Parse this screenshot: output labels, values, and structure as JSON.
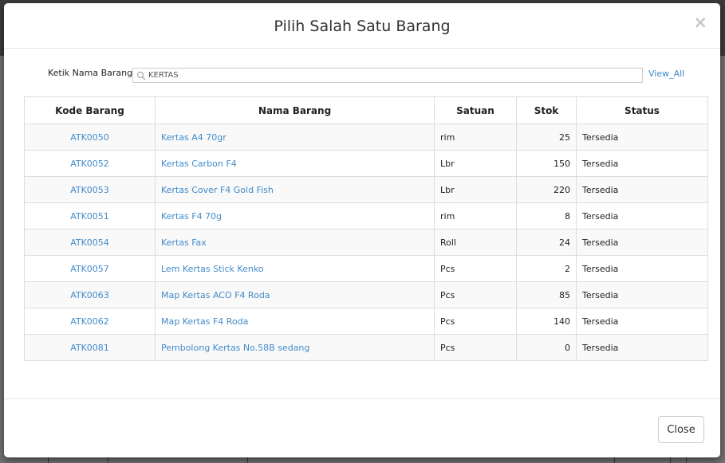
{
  "modal": {
    "title": "Pilih Salah Satu Barang",
    "close_symbol": "×",
    "close_button": "Close"
  },
  "search": {
    "label": "Ketik Nama Barang :",
    "value": "KERTAS",
    "view_all": "View_All"
  },
  "table": {
    "headers": [
      "Kode Barang",
      "Nama Barang",
      "Satuan",
      "Stok",
      "Status"
    ],
    "rows": [
      {
        "kode": "ATK0050",
        "nama": "Kertas A4 70gr",
        "satuan": "rim",
        "stok": "25",
        "status": "Tersedia"
      },
      {
        "kode": "ATK0052",
        "nama": "Kertas Carbon F4",
        "satuan": "Lbr",
        "stok": "150",
        "status": "Tersedia"
      },
      {
        "kode": "ATK0053",
        "nama": "Kertas Cover F4 Gold Fish",
        "satuan": "Lbr",
        "stok": "220",
        "status": "Tersedia"
      },
      {
        "kode": "ATK0051",
        "nama": "Kertas F4 70g",
        "satuan": "rim",
        "stok": "8",
        "status": "Tersedia"
      },
      {
        "kode": "ATK0054",
        "nama": "Kertas Fax",
        "satuan": "Roll",
        "stok": "24",
        "status": "Tersedia"
      },
      {
        "kode": "ATK0057",
        "nama": "Lem Kertas Stick Kenko",
        "satuan": "Pcs",
        "stok": "2",
        "status": "Tersedia"
      },
      {
        "kode": "ATK0063",
        "nama": "Map Kertas ACO F4 Roda",
        "satuan": "Pcs",
        "stok": "85",
        "status": "Tersedia"
      },
      {
        "kode": "ATK0062",
        "nama": "Map Kertas F4 Roda",
        "satuan": "Pcs",
        "stok": "140",
        "status": "Tersedia"
      },
      {
        "kode": "ATK0081",
        "nama": "Pembolong Kertas No.58B sedang",
        "satuan": "Pcs",
        "stok": "0",
        "status": "Tersedia"
      }
    ]
  },
  "icons": {
    "search": "search-icon",
    "close": "close-icon"
  },
  "colors": {
    "link": "#428bca",
    "border": "#dddddd",
    "stripe": "#f9f9f9"
  }
}
